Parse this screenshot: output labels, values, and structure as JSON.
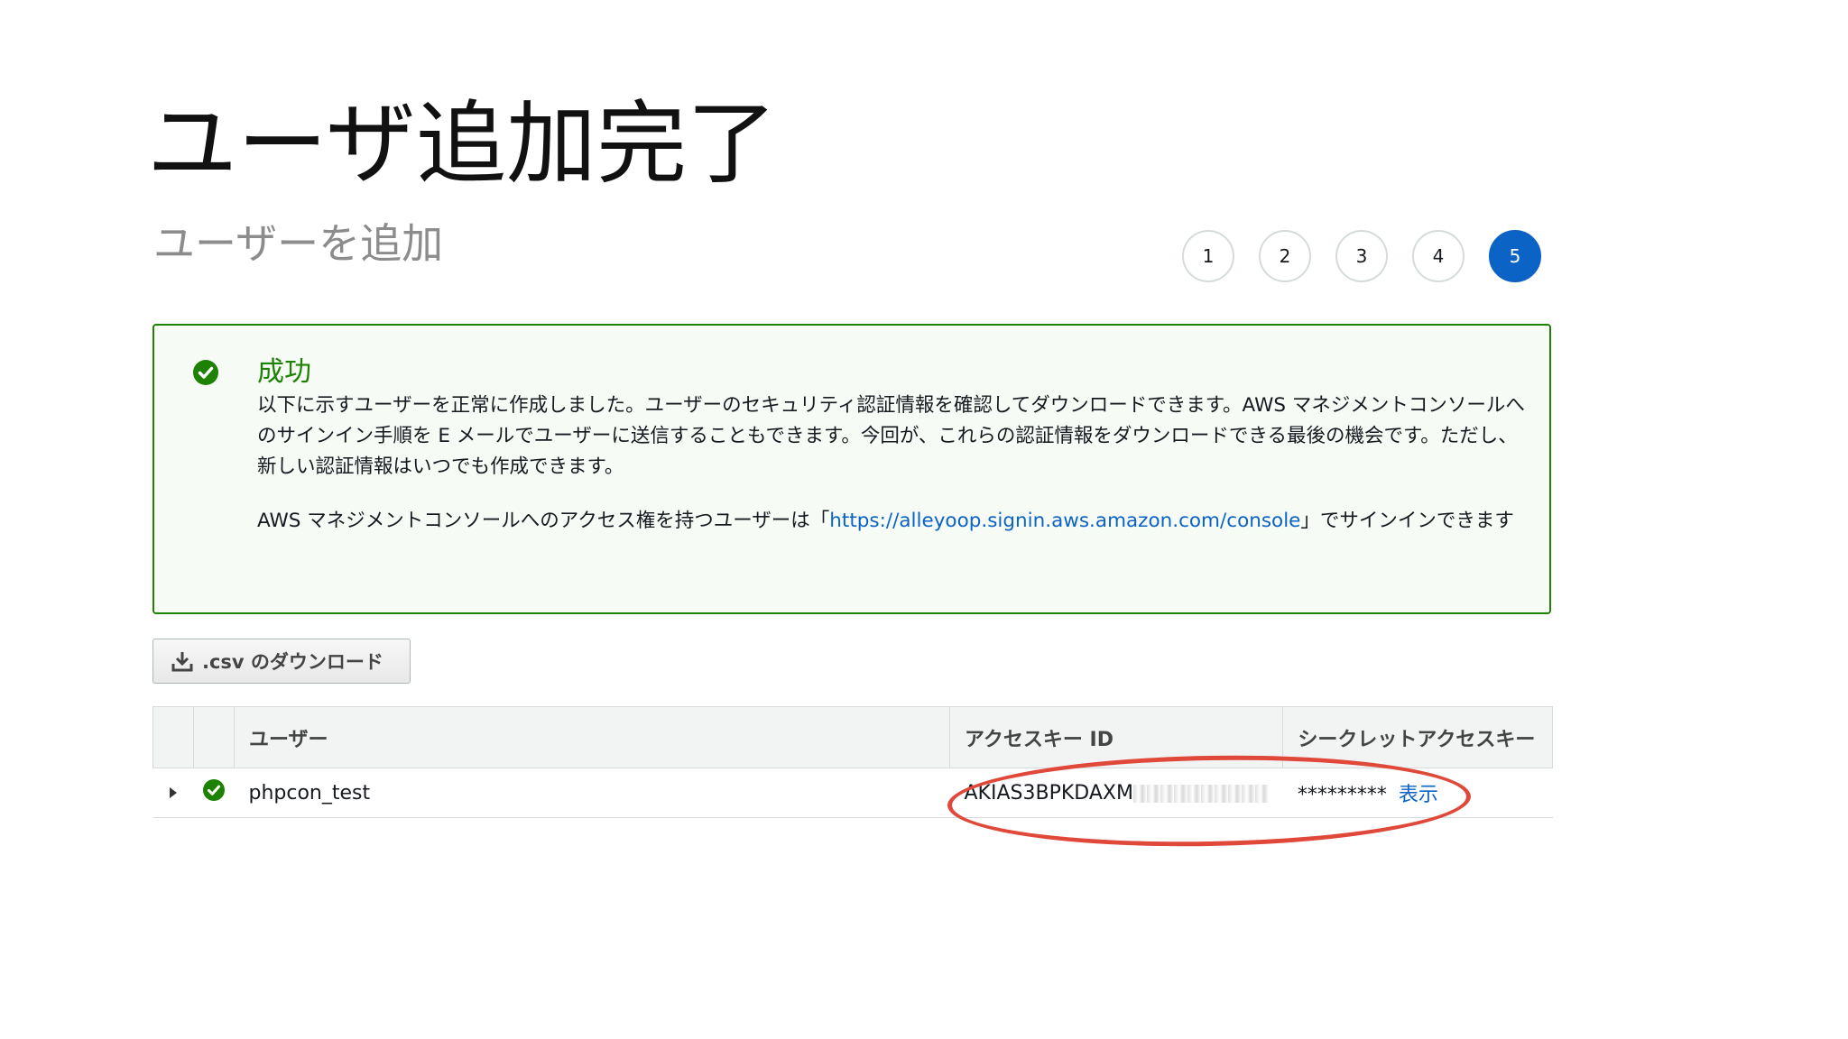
{
  "slide": {
    "title": "ユーザ追加完了"
  },
  "page": {
    "title": "ユーザーを追加"
  },
  "stepper": {
    "steps": [
      "1",
      "2",
      "3",
      "4",
      "5"
    ],
    "active_step": "5"
  },
  "alert": {
    "title": "成功",
    "message": "以下に示すユーザーを正常に作成しました。ユーザーのセキュリティ認証情報を確認してダウンロードできます。AWS マネジメントコンソールへのサインイン手順を E メールでユーザーに送信することもできます。今回が、これらの認証情報をダウンロードできる最後の機会です。ただし、新しい認証情報はいつでも作成できます。",
    "signin_prefix": "AWS マネジメントコンソールへのアクセス権を持つユーザーは「",
    "signin_url": "https://alleyoop.signin.aws.amazon.com/console",
    "signin_suffix": "」でサインインできます",
    "colors": {
      "border": "#1d8102",
      "title": "#1d8102",
      "link": "#0b63c5"
    }
  },
  "actions": {
    "download_csv_label": ".csv のダウンロード"
  },
  "table": {
    "headers": {
      "user": "ユーザー",
      "access_key_id": "アクセスキー ID",
      "secret_access_key": "シークレットアクセスキー"
    },
    "rows": [
      {
        "user": "phpcon_test",
        "access_key_id": "AKIAS3BPKDAXM",
        "secret_access_key": "*********",
        "show_label": "表示"
      }
    ]
  },
  "annotation": {
    "highlight_color": "#e0483a"
  }
}
